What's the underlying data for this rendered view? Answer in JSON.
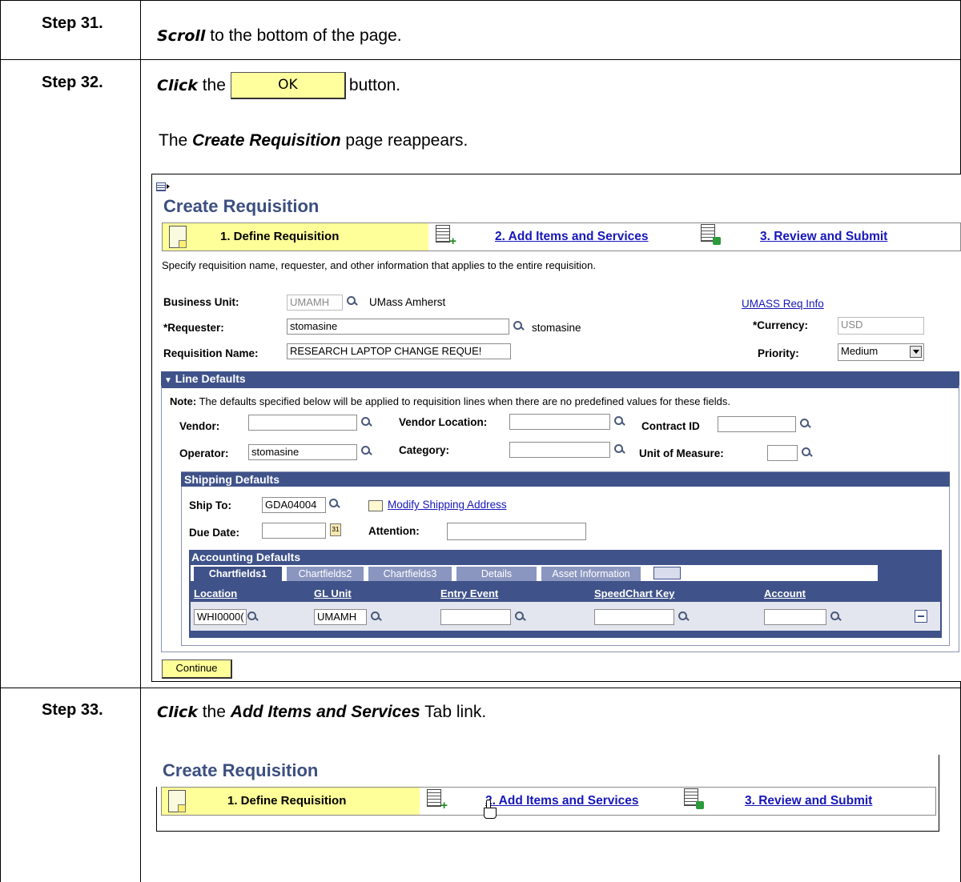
{
  "steps": [
    {
      "label": "Step 31.",
      "verb": "Scroll",
      "text": "to the bottom of the page."
    },
    {
      "label": "Step 32.",
      "verb": "Click",
      "text_before": "the",
      "ok_label": "OK",
      "text_after": "button.",
      "note_pre": "The",
      "note_emph": "Create Requisition",
      "note_post": "page reappears."
    },
    {
      "label": "Step 33.",
      "verb": "Click",
      "text_before": "the",
      "emph": "Add Items and Services",
      "text_after": "Tab link."
    }
  ],
  "screen": {
    "title": "Create Requisition",
    "tabs": {
      "define": "1. Define Requisition",
      "add": "2. Add Items and Services",
      "review": "3. Review and Submit"
    },
    "instructions": "Specify requisition name, requester, and other information that applies to the entire requisition.",
    "business_unit_label": "Business Unit:",
    "business_unit_value": "UMAMH",
    "business_unit_desc": "UMass Amherst",
    "req_info_link": "UMASS Req Info",
    "requester_label": "*Requester:",
    "requester_value": "stomasine",
    "requester_desc": "stomasine",
    "currency_label": "*Currency:",
    "currency_value": "USD",
    "req_name_label": "Requisition Name:",
    "req_name_value": "RESEARCH LAPTOP CHANGE REQUE!",
    "priority_label": "Priority:",
    "priority_value": "Medium",
    "line_defaults": {
      "title": "Line Defaults",
      "note_bold": "Note:",
      "note": "The defaults specified below will be applied to requisition lines when there are no predefined values for these fields.",
      "vendor_label": "Vendor:",
      "vendor_location_label": "Vendor Location:",
      "contract_label": "Contract ID",
      "operator_label": "Operator:",
      "operator_value": "stomasine",
      "category_label": "Category:",
      "uom_label": "Unit of Measure:"
    },
    "shipping": {
      "title": "Shipping Defaults",
      "ship_to_label": "Ship To:",
      "ship_to_value": "GDA04004",
      "modify_link": "Modify Shipping Address",
      "due_date_label": "Due Date:",
      "attention_label": "Attention:"
    },
    "accounting": {
      "title": "Accounting Defaults",
      "tabs": [
        "Chartfields1",
        "Chartfields2",
        "Chartfields3",
        "Details",
        "Asset Information"
      ],
      "columns": [
        "Location",
        "GL Unit",
        "Entry Event",
        "SpeedChart Key",
        "Account"
      ],
      "row": {
        "location": "WHI0000(",
        "gl_unit": "UMAMH"
      }
    },
    "continue_label": "Continue"
  },
  "screen2": {
    "title": "Create Requisition",
    "tabs": {
      "define": "1. Define Requisition",
      "add": "2. Add Items and Services",
      "review": "3. Review and Submit"
    }
  },
  "colors": {
    "tab_yellow": "#ffff99",
    "header_blue": "#3f5289",
    "title_blue": "#3c4f80",
    "link_blue": "#1717ba"
  }
}
